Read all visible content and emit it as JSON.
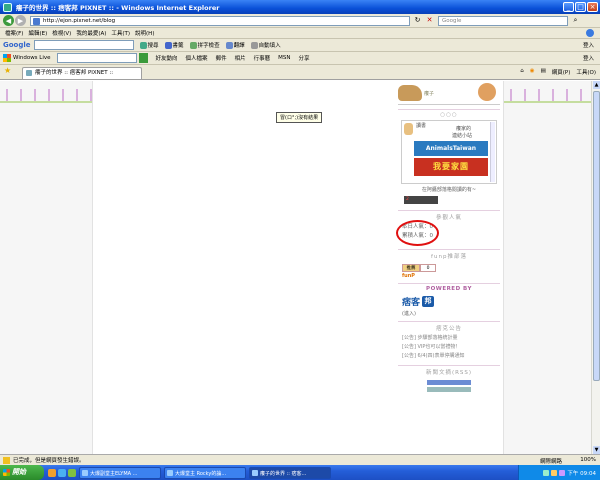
{
  "window": {
    "title": "癢子的世界 :: 痞客邦 PIXNET :: - Windows Internet Explorer"
  },
  "address": {
    "url": "http://ejon.pixnet.net/blog",
    "search_placeholder": "Google"
  },
  "menu": [
    "檔案(F)",
    "編輯(E)",
    "檢視(V)",
    "我的最愛(A)",
    "工具(T)",
    "說明(H)"
  ],
  "google_toolbar": {
    "logo": "Google",
    "items": [
      "搜尋",
      "書籤",
      "拼字檢查",
      "翻譯",
      "自動填入"
    ],
    "login": "登入"
  },
  "live_toolbar": {
    "logo": "Windows Live",
    "items": [
      "好友動向",
      "個人檔案",
      "郵件",
      "相片",
      "行事曆",
      "MSN",
      "分享"
    ],
    "login": "登入"
  },
  "tab": {
    "title": "癢子的世界 :: 痞客邦 PIXNET ::",
    "right_items": [
      "網頁(P)",
      "工具(O)"
    ]
  },
  "page": {
    "tooltip": "冒(ロ°;)沒有結果",
    "banner_text": "癢子",
    "linkbox_top": "讀書",
    "linkbox_top2": "癢家的",
    "linkbox_top3": "連結小站",
    "at_banner": "AnimalsTaiwan",
    "red_banner": "我要家園",
    "linkbox_caption": "在阿醬部落格閱讀的有~",
    "badge_text": "2",
    "visitor_title": "參觀人氣",
    "visitor_today": "本日人氣：0",
    "visitor_total": "累積人氣：0",
    "funp_title": "funp推部落",
    "funp_b1": "推薦",
    "funp_b2": "0",
    "funp_logo": "funP",
    "powered_title": "POWERED BY",
    "pixnet_logo": "痞客",
    "pixnet_box": "邦",
    "join": "(進入)",
    "ann_title": "痞克公告",
    "announcements": [
      "[公告] 步驟部落格統計量",
      "[公告] VIP也可以當禮物！",
      "[公告] 6/4(四)表單停購通知"
    ],
    "rss_title": "新聞文摘(RSS)"
  },
  "status": {
    "text": "已完成，但是網頁發生錯誤。",
    "zone": "網際網路",
    "zoom": "100%"
  },
  "taskbar": {
    "start": "開始",
    "tasks": [
      "大爆副堂主ELYMA ...",
      "大爆堂主 Rocky的論...",
      "癢子的世界 :: 痞客..."
    ],
    "clock": "下午 09:04"
  }
}
